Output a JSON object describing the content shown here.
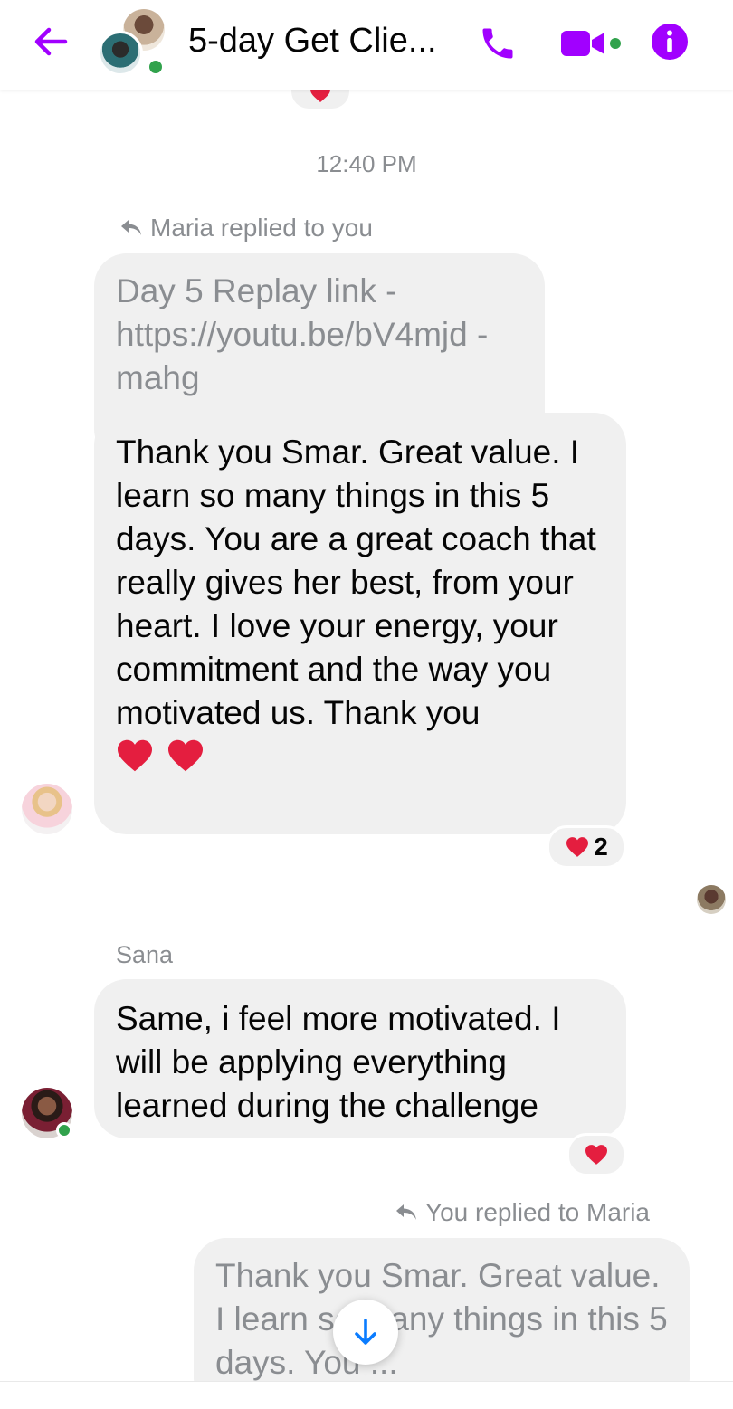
{
  "header": {
    "title": "5-day Get Clie...",
    "back_icon": "arrow-left-icon",
    "call_icon": "phone-icon",
    "video_icon": "video-camera-icon",
    "info_icon": "info-icon",
    "accent_color": "#a100ff"
  },
  "conversation": {
    "timestamp": "12:40 PM",
    "reply1": {
      "label": "Maria replied to you",
      "quoted": "Day 5 Replay link - https://youtu.be/bV4mjd -mahg",
      "message": "Thank you Smar. Great value. I learn so many things in this 5 days. You are a great coach that really gives her best, from your heart. I love your energy, your commitment and the way you motivated us. Thank you",
      "reaction_count": "2"
    },
    "sana": {
      "sender": "Sana",
      "message": "Same, i feel more motivated. I will be applying everything learned during the challenge"
    },
    "reply2": {
      "label": "You replied to Maria",
      "quoted": "Thank you Smar. Great value. I learn so many things in this 5 days. You ..."
    }
  }
}
